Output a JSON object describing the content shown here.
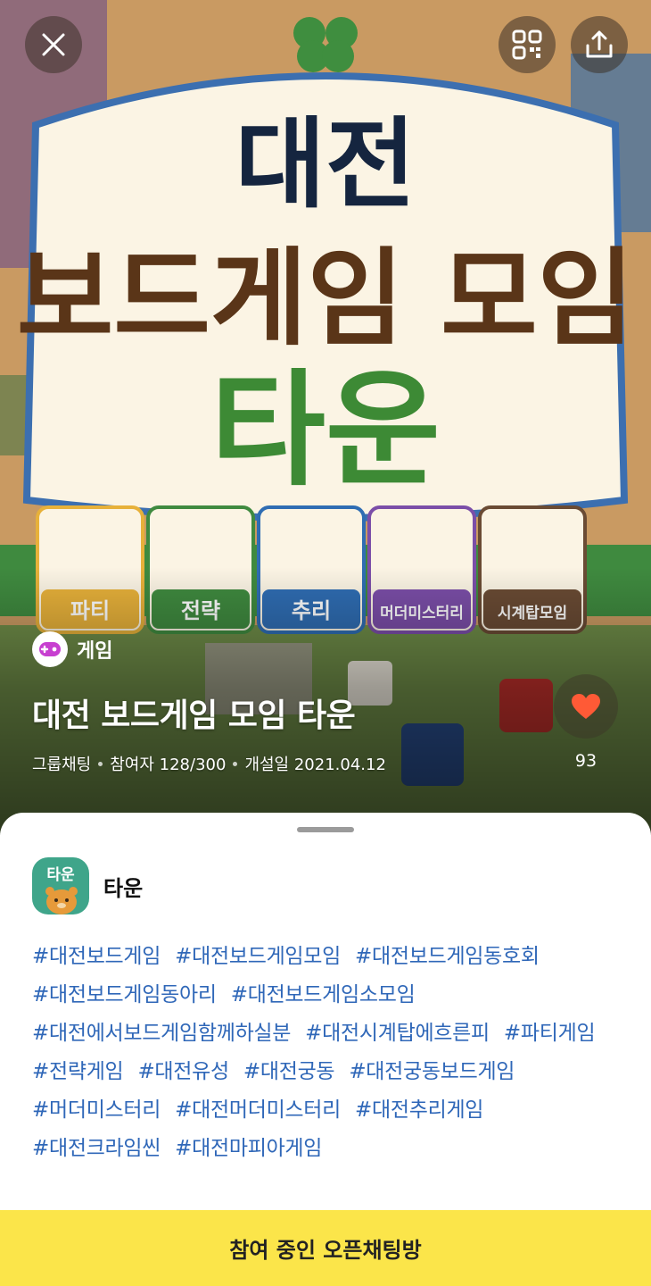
{
  "header": {
    "close_icon": "close-icon",
    "qr_icon": "qr-code-icon",
    "share_icon": "share-icon"
  },
  "hero": {
    "banner_title_line1": "대전",
    "banner_title_line2": "보드게임 모임",
    "banner_title_line3": "타운",
    "genres": [
      "파티",
      "전략",
      "추리",
      "머더미스터리",
      "시계탑모임"
    ],
    "genre_colors": [
      "#e7b13a",
      "#3f8a3f",
      "#2f6db3",
      "#7b4ea8",
      "#6a4b34"
    ]
  },
  "category": {
    "label": "게임",
    "icon": "game-controller-icon"
  },
  "room": {
    "title": "대전 보드게임 모임 타운",
    "type": "그룹채팅",
    "participants": "참여자 128/300",
    "created": "개설일 2021.04.12",
    "likes": "93"
  },
  "host": {
    "name": "타운",
    "avatar_text": "타운"
  },
  "tags": [
    "#대전보드게임",
    "#대전보드게임모임",
    "#대전보드게임동호회",
    "#대전보드게임동아리",
    "#대전보드게임소모임",
    "#대전에서보드게임함께하실분",
    "#대전시계탑에흐른피",
    "#파티게임",
    "#전략게임",
    "#대전유성",
    "#대전궁동",
    "#대전궁동보드게임",
    "#머더미스터리",
    "#대전머더미스터리",
    "#대전추리게임",
    "#대전크라임씬",
    "#대전마피아게임"
  ],
  "actions": {
    "join_label": "참여 중인 오픈채팅방"
  },
  "colors": {
    "tag": "#2f67b8",
    "join_bar": "#fbe54a",
    "heart": "#ff5a36"
  }
}
